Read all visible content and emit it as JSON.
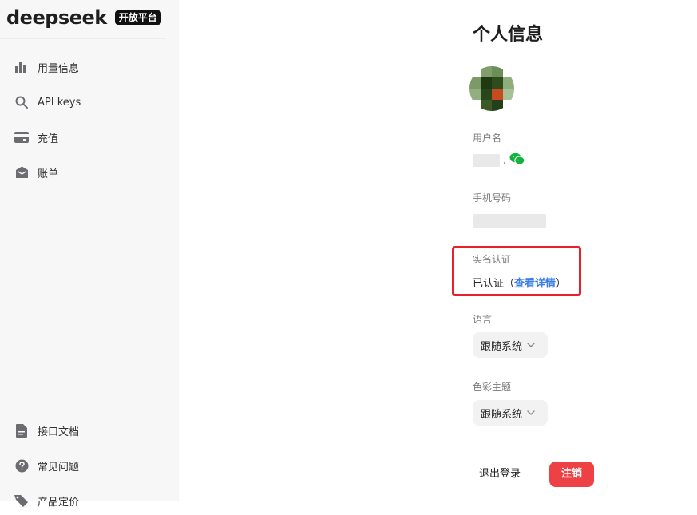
{
  "brand": {
    "logo_text": "deepseek",
    "badge": "开放平台"
  },
  "sidebar": {
    "items": [
      {
        "label": "用量信息",
        "icon": "bar-chart-icon"
      },
      {
        "label": "API keys",
        "icon": "search-icon"
      },
      {
        "label": "充值",
        "icon": "wallet-icon"
      },
      {
        "label": "账单",
        "icon": "envelope-icon"
      }
    ],
    "bottom_items": [
      {
        "label": "接口文档",
        "icon": "document-icon"
      },
      {
        "label": "常见问题",
        "icon": "question-icon"
      },
      {
        "label": "产品定价",
        "icon": "tag-icon"
      }
    ]
  },
  "profile": {
    "title": "个人信息",
    "username_label": "用户名",
    "username_separator": ",",
    "phone_label": "手机号码",
    "verification_label": "实名认证",
    "verification_status": "已认证（",
    "verification_link": "查看详情",
    "verification_close": "）",
    "language_label": "语言",
    "language_value": "跟随系统",
    "theme_label": "色彩主题",
    "theme_value": "跟随系统",
    "logout": "退出登录",
    "cancel_account": "注销"
  },
  "colors": {
    "accent_link": "#3b7ee8",
    "danger": "#ee4146",
    "highlight_box": "#e8202a",
    "wechat": "#12b23e"
  }
}
